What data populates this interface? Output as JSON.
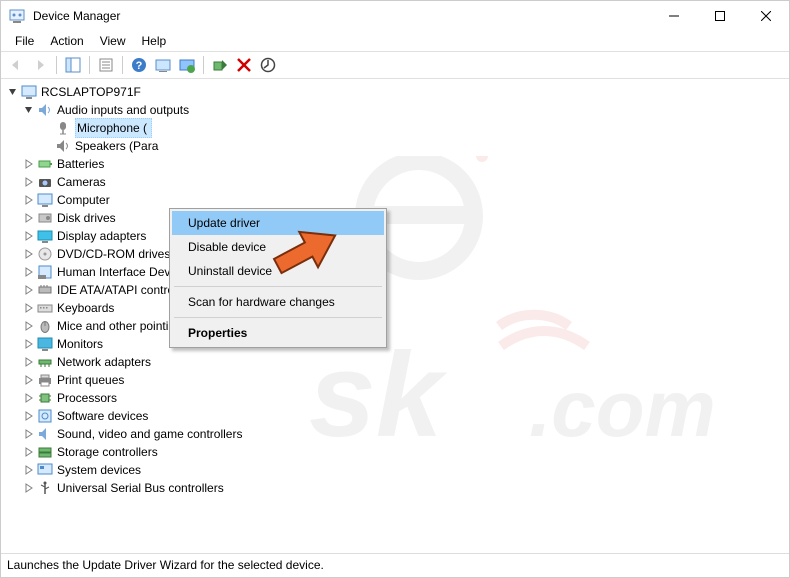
{
  "window": {
    "title": "Device Manager"
  },
  "menubar": {
    "file": "File",
    "action": "Action",
    "view": "View",
    "help": "Help"
  },
  "tree": {
    "root": "RCSLAPTOP971F",
    "audio_cat": "Audio inputs and outputs",
    "microphone": "Microphone (",
    "speakers": "Speakers (Para",
    "batteries": "Batteries",
    "cameras": "Cameras",
    "computer": "Computer",
    "disk_drives": "Disk drives",
    "display_adapters": "Display adapters",
    "dvd": "DVD/CD-ROM drives",
    "hid": "Human Interface Devices",
    "ide": "IDE ATA/ATAPI controllers",
    "keyboards": "Keyboards",
    "mice": "Mice and other pointing devices",
    "monitors": "Monitors",
    "network": "Network adapters",
    "print": "Print queues",
    "processors": "Processors",
    "software": "Software devices",
    "sound": "Sound, video and game controllers",
    "storage": "Storage controllers",
    "system": "System devices",
    "usb": "Universal Serial Bus controllers"
  },
  "context_menu": {
    "update": "Update driver",
    "disable": "Disable device",
    "uninstall": "Uninstall device",
    "scan": "Scan for hardware changes",
    "properties": "Properties"
  },
  "statusbar": {
    "text": "Launches the Update Driver Wizard for the selected device."
  }
}
